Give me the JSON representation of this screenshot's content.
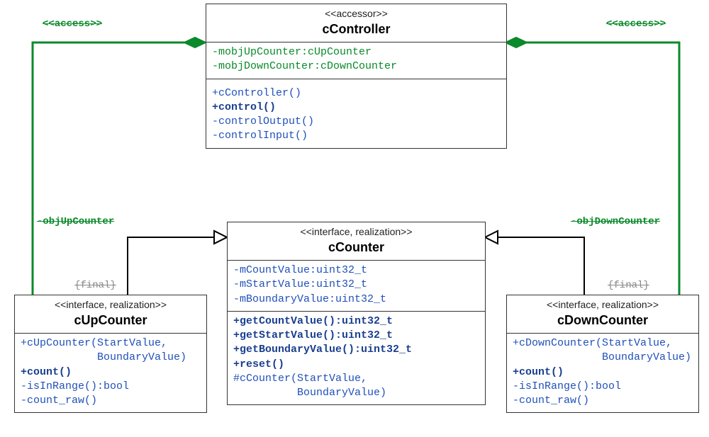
{
  "classes": {
    "controller": {
      "stereo": "<<accessor>>",
      "name": "cController",
      "attrs": [
        "-mobjUpCounter:cUpCounter",
        "-mobjDownCounter:cDownCounter"
      ],
      "ops": [
        {
          "text": "+cController()",
          "bold": false
        },
        {
          "text": "+control()",
          "bold": true
        },
        {
          "text": "-controlOutput()",
          "bold": false
        },
        {
          "text": "-controlInput()",
          "bold": false
        }
      ]
    },
    "counter": {
      "stereo": "<<interface, realization>>",
      "name": "cCounter",
      "attrs": [
        "-mCountValue:uint32_t",
        "-mStartValue:uint32_t",
        "-mBoundaryValue:uint32_t"
      ],
      "ops": [
        {
          "text": "+getCountValue():uint32_t",
          "bold": true
        },
        {
          "text": "+getStartValue():uint32_t",
          "bold": true
        },
        {
          "text": "+getBoundaryValue():uint32_t",
          "bold": true
        },
        {
          "text": "+reset()",
          "bold": true
        },
        {
          "text": "#cCounter(StartValue,",
          "bold": false
        },
        {
          "text": "          BoundaryValue)",
          "bold": false
        }
      ]
    },
    "upcounter": {
      "stereo": "<<interface, realization>>",
      "name": "cUpCounter",
      "ops": [
        {
          "text": "+cUpCounter(StartValue,",
          "bold": false
        },
        {
          "text": "            BoundaryValue)",
          "bold": false
        },
        {
          "text": "+count()",
          "bold": true
        },
        {
          "text": "-isInRange():bool",
          "bold": false
        },
        {
          "text": "-count_raw()",
          "bold": false
        }
      ]
    },
    "downcounter": {
      "stereo": "<<interface, realization>>",
      "name": "cDownCounter",
      "ops": [
        {
          "text": "+cDownCounter(StartValue,",
          "bold": false
        },
        {
          "text": "              BoundaryValue)",
          "bold": false
        },
        {
          "text": "+count()",
          "bold": true
        },
        {
          "text": "-isInRange():bool",
          "bold": false
        },
        {
          "text": "-count_raw()",
          "bold": false
        }
      ]
    }
  },
  "labels": {
    "access_left": "<<access>>",
    "access_right": "<<access>>",
    "objUp": "-objUpCounter",
    "objDown": "-objDownCounter",
    "final_left": "{final}",
    "final_right": "{final}"
  },
  "colors": {
    "green": "#0a8a2a",
    "blue": "#2050b9",
    "black": "#000000"
  }
}
